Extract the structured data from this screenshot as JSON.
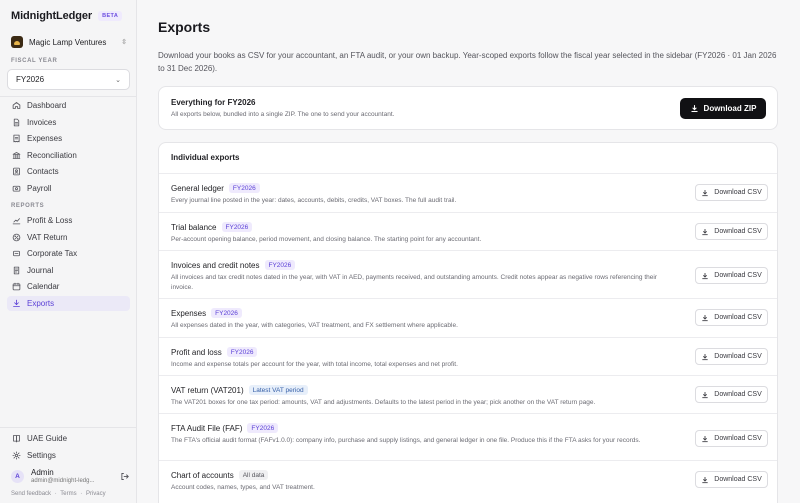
{
  "sidebar": {
    "brand": "MidnightLedger",
    "badge": "BETA",
    "org": "Magic Lamp Ventures",
    "fiscal_year_label": "FISCAL YEAR",
    "fiscal_year_value": "FY2026",
    "nav_main": [
      {
        "label": "Dashboard",
        "icon": "home-icon"
      },
      {
        "label": "Invoices",
        "icon": "document-icon"
      },
      {
        "label": "Expenses",
        "icon": "receipt-icon"
      },
      {
        "label": "Reconciliation",
        "icon": "bank-icon"
      },
      {
        "label": "Contacts",
        "icon": "contacts-icon"
      },
      {
        "label": "Payroll",
        "icon": "payroll-icon"
      }
    ],
    "reports_label": "REPORTS",
    "nav_reports": [
      {
        "label": "Profit & Loss",
        "icon": "chart-icon"
      },
      {
        "label": "VAT Return",
        "icon": "vat-icon"
      },
      {
        "label": "Corporate Tax",
        "icon": "tax-icon"
      },
      {
        "label": "Journal",
        "icon": "journal-icon"
      },
      {
        "label": "Calendar",
        "icon": "calendar-icon"
      },
      {
        "label": "Exports",
        "icon": "download-icon",
        "active": true
      }
    ],
    "nav_bottom": [
      {
        "label": "UAE Guide",
        "icon": "book-icon"
      },
      {
        "label": "Settings",
        "icon": "gear-icon"
      }
    ],
    "user": {
      "initial": "A",
      "name": "Admin",
      "email": "admin@midnight-ledg..."
    },
    "footer": {
      "feedback": "Send feedback",
      "terms": "Terms",
      "privacy": "Privacy",
      "dot": "·"
    }
  },
  "main": {
    "title": "Exports",
    "description": "Download your books as CSV for your accountant, an FTA audit, or your own backup. Year-scoped exports follow the fiscal year selected in the sidebar (FY2026 · 01 Jan 2026 to 31 Dec 2026).",
    "bundle": {
      "title": "Everything for FY2026",
      "subtitle": "All exports below, bundled into a single ZIP. The one to send your accountant.",
      "button": "Download ZIP"
    },
    "individual_title": "Individual exports",
    "csv_button": "Download CSV",
    "exports": [
      {
        "title": "General ledger",
        "tag": "FY2026",
        "tag_style": "purple",
        "desc": "Every journal line posted in the year: dates, accounts, debits, credits, VAT boxes. The full audit trail."
      },
      {
        "title": "Trial balance",
        "tag": "FY2026",
        "tag_style": "purple",
        "desc": "Per-account opening balance, period movement, and closing balance. The starting point for any accountant."
      },
      {
        "title": "Invoices and credit notes",
        "tag": "FY2026",
        "tag_style": "purple",
        "desc": "All invoices and tax credit notes dated in the year, with VAT in AED, payments received, and outstanding amounts. Credit notes appear as negative rows referencing their invoice."
      },
      {
        "title": "Expenses",
        "tag": "FY2026",
        "tag_style": "purple",
        "desc": "All expenses dated in the year, with categories, VAT treatment, and FX settlement where applicable."
      },
      {
        "title": "Profit and loss",
        "tag": "FY2026",
        "tag_style": "purple",
        "desc": "Income and expense totals per account for the year, with total income, total expenses and net profit."
      },
      {
        "title": "VAT return (VAT201)",
        "tag": "Latest VAT period",
        "tag_style": "blue",
        "desc": "The VAT201 boxes for one tax period: amounts, VAT and adjustments. Defaults to the latest period in the year; pick another on the VAT return page."
      },
      {
        "title": "FTA Audit File (FAF)",
        "tag": "FY2026",
        "tag_style": "purple",
        "desc": "The FTA's official audit format (FAFv1.0.0): company info, purchase and supply listings, and general ledger in one file. Produce this if the FTA asks for your records."
      },
      {
        "title": "Chart of accounts",
        "tag": "All data",
        "tag_style": "gray",
        "desc": "Account codes, names, types, and VAT treatment."
      }
    ]
  }
}
